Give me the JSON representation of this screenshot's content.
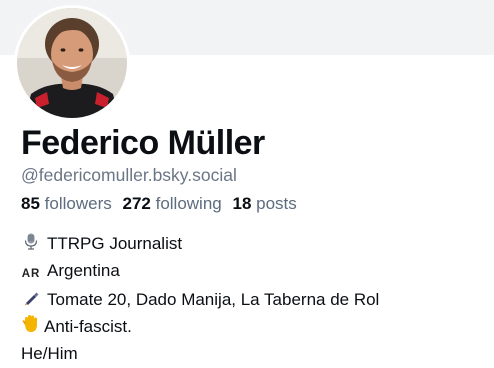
{
  "profile": {
    "display_name": "Federico Müller",
    "handle": "@federicomuller.bsky.social",
    "avatar_icon": "avatar-photo",
    "stats": {
      "followers_count": "85",
      "followers_label": "followers",
      "following_count": "272",
      "following_label": "following",
      "posts_count": "18",
      "posts_label": "posts"
    },
    "bio": [
      {
        "icon": "microphone-icon",
        "text": "TTRPG Journalist"
      },
      {
        "icon": "regional-indicator-icon",
        "icon_text": "AR",
        "text": "Argentina"
      },
      {
        "icon": "pen-icon",
        "text": "Tomate 20, Dado Manija, La Taberna de Rol"
      },
      {
        "icon": "raised-hand-icon",
        "text": "Anti-fascist."
      },
      {
        "text": "He/Him"
      }
    ]
  },
  "colors": {
    "banner": "#f1f3f5",
    "text_primary": "#0b0f14",
    "text_secondary": "#6a7686"
  }
}
